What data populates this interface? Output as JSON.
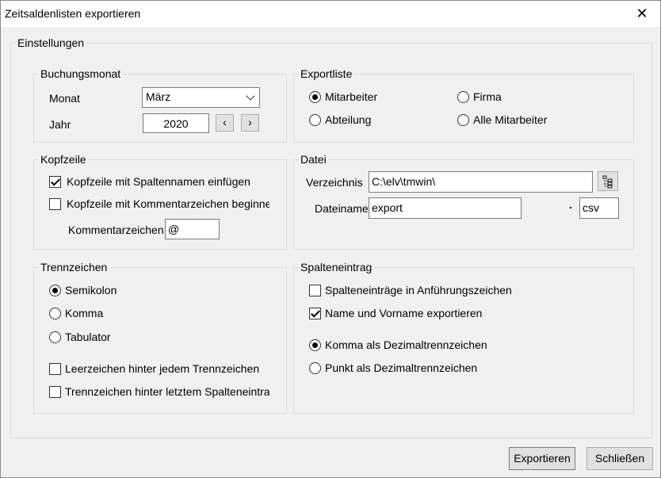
{
  "window": {
    "title": "Zeitsaldenlisten exportieren",
    "close_glyph": "✕"
  },
  "settings": {
    "legend": "Einstellungen"
  },
  "buchungsmonat": {
    "legend": "Buchungsmonat",
    "monat_label": "Monat",
    "monat_value": "März",
    "jahr_label": "Jahr",
    "jahr_value": "2020",
    "prev_glyph": "‹",
    "next_glyph": "›"
  },
  "exportliste": {
    "legend": "Exportliste",
    "mitarbeiter": "Mitarbeiter",
    "firma": "Firma",
    "abteilung": "Abteilung",
    "alle_mitarbeiter": "Alle Mitarbeiter",
    "selected": "Mitarbeiter"
  },
  "kopfzeile": {
    "legend": "Kopfzeile",
    "spaltennamen": "Kopfzeile mit Spaltennamen einfügen",
    "spaltennamen_checked": true,
    "kommentarzeichen_beginnen": "Kopfzeile mit Kommentarzeichen beginnen",
    "kommentarzeichen_beginnen_checked": false,
    "kommentarzeichen_label": "Kommentarzeichen",
    "kommentarzeichen_value": "@"
  },
  "datei": {
    "legend": "Datei",
    "verzeichnis_label": "Verzeichnis",
    "verzeichnis_value": "C:\\elv\\tmwin\\",
    "dateiname_label": "Dateiname",
    "dateiname_value": "export",
    "extension_separator": ".",
    "extension_value": "csv"
  },
  "trennzeichen": {
    "legend": "Trennzeichen",
    "semikolon": "Semikolon",
    "komma": "Komma",
    "tabulator": "Tabulator",
    "selected": "Semikolon",
    "leerzeichen": "Leerzeichen hinter jedem Trennzeichen",
    "leerzeichen_checked": false,
    "letztem": "Trennzeichen hinter letztem Spalteneintrag",
    "letztem_checked": false
  },
  "spalteneintrag": {
    "legend": "Spalteneintrag",
    "anfuehrungszeichen": "Spalteneinträge in Anführungszeichen",
    "anfuehrungszeichen_checked": false,
    "name_vorname": "Name und Vorname exportieren",
    "name_vorname_checked": true,
    "komma_dezimal": "Komma als Dezimaltrennzeichen",
    "punkt_dezimal": "Punkt als Dezimaltrennzeichen",
    "dezimal_selected": "Komma"
  },
  "buttons": {
    "exportieren": "Exportieren",
    "schliessen": "Schließen"
  }
}
